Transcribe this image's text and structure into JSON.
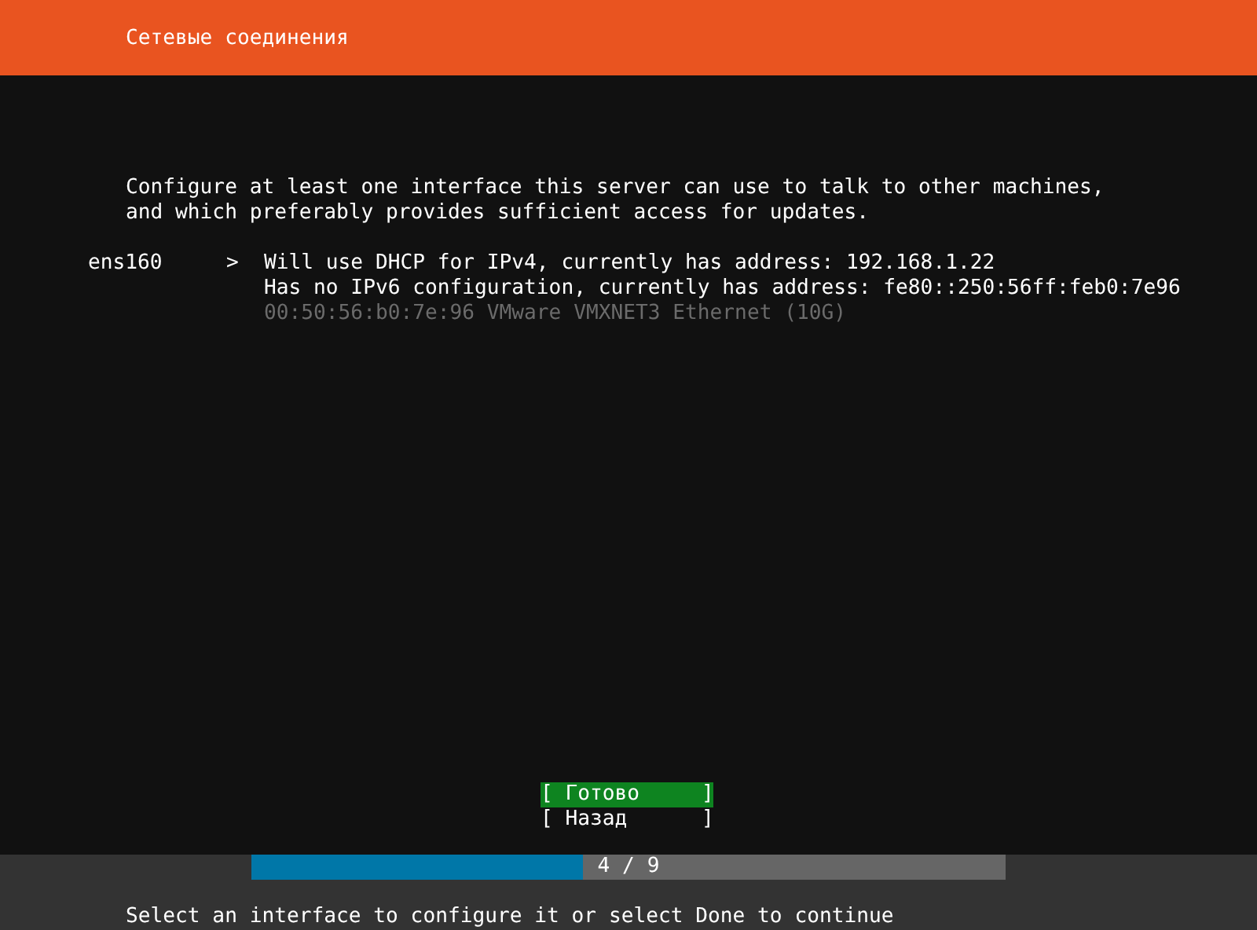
{
  "header": {
    "title": "Сетевые соединения"
  },
  "intro": [
    "Configure at least one interface this server can use to talk to other machines,",
    "and which preferably provides sufficient access for updates."
  ],
  "interfaces": [
    {
      "name": "ens160",
      "arrow": ">",
      "lines": [
        {
          "kind": "info",
          "text": "Will use DHCP for IPv4, currently has address: 192.168.1.22"
        },
        {
          "kind": "info",
          "text": "Has no IPv6 configuration, currently has address: fe80::250:56ff:feb0:7e96"
        },
        {
          "kind": "muted",
          "text": "00:50:56:b0:7e:96 VMware VMXNET3 Ethernet (10G)"
        }
      ]
    }
  ],
  "buttons": [
    {
      "label": "[ Готово     ]",
      "selected": true
    },
    {
      "label": "[ Назад      ]",
      "selected": false
    }
  ],
  "progress": {
    "label": "4 / 9",
    "level": 0.44
  },
  "status_bar": "Select an interface to configure it or select Done to continue"
}
